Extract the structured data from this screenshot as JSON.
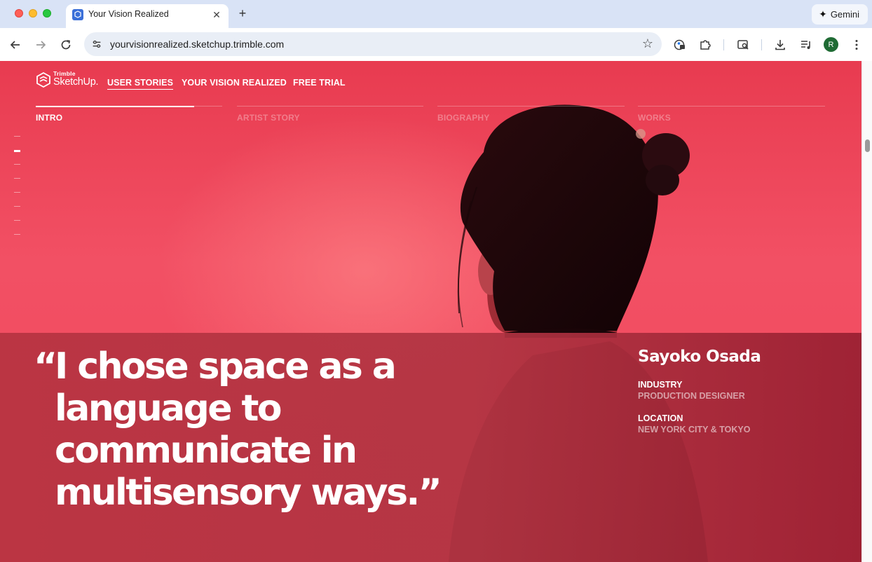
{
  "browser": {
    "tab_title": "Your Vision Realized",
    "tab_close": "✕",
    "new_tab": "+",
    "gemini_label": "Gemini",
    "url": "yourvisionrealized.sketchup.trimble.com",
    "avatar_letter": "R",
    "icons": {
      "back": "arrow-left-icon",
      "forward": "arrow-right-icon",
      "reload": "reload-icon",
      "site_info": "tune-icon",
      "bookmark": "star-icon",
      "password_manager": "key-lock-icon",
      "extensions": "puzzle-icon",
      "lens": "search-page-icon",
      "downloads": "download-icon",
      "media": "media-queue-icon",
      "menu": "kebab-menu-icon"
    }
  },
  "site": {
    "logo": {
      "small": "Trimble",
      "big": "SketchUp."
    },
    "nav": [
      {
        "label": "USER STORIES",
        "active": true
      },
      {
        "label": "YOUR VISION REALIZED",
        "active": false
      },
      {
        "label": "FREE TRIAL",
        "active": false
      }
    ],
    "sections": [
      {
        "label": "INTRO",
        "active": true
      },
      {
        "label": "ARTIST STORY",
        "active": false
      },
      {
        "label": "BIOGRAPHY",
        "active": false
      },
      {
        "label": "WORKS",
        "active": false
      }
    ],
    "intro_progress": 0.85,
    "side_indicator": {
      "count": 8,
      "active_index": 1
    }
  },
  "hero": {
    "quote_open": "“",
    "quote_lines": [
      "I chose space as a",
      "language to",
      "communicate in",
      "multisensory ways.”"
    ],
    "person": {
      "name": "Sayoko Osada",
      "industry_label": "INDUSTRY",
      "industry_value": "PRODUCTION DESIGNER",
      "location_label": "LOCATION",
      "location_value": "NEW YORK CITY & TOKYO"
    }
  },
  "colors": {
    "hero_red": "#f0475c",
    "band_red": "#b53442",
    "chrome_tabbar": "#d9e3f6"
  }
}
